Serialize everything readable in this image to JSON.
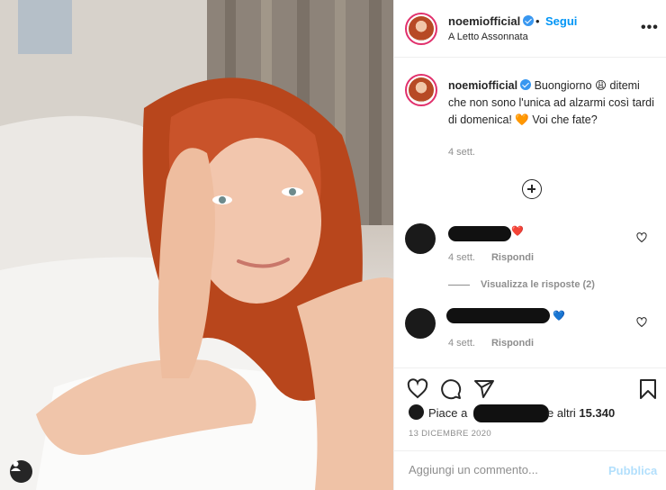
{
  "post": {
    "username": "noemiofficial",
    "follow_label": "Segui",
    "dot": "•",
    "location": "A Letto Assonnata",
    "more": "•••",
    "caption_text": "Buongiorno 😩 ditemi che non sono l'unica ad alzarmi così tardi di domenica! 🧡 Voi che fate?",
    "caption_time": "4 sett."
  },
  "comments": [
    {
      "emoji": "❤️",
      "time": "4 sett.",
      "reply_label": "Rispondi"
    },
    {
      "emoji": "💙",
      "time": "4 sett.",
      "reply_label": "Rispondi"
    }
  ],
  "view_replies": "Visualizza le risposte (2)",
  "likes": {
    "prefix": "Piace a",
    "suffix_pre": "e altri",
    "count": "15.340"
  },
  "date": "13 DICEMBRE 2020",
  "comment_box": {
    "placeholder": "Aggiungi un commento...",
    "publish_label": "Pubblica"
  },
  "icons": [
    "user-tag-icon",
    "verified-badge-icon",
    "more-options-icon",
    "load-more-comments-icon",
    "like-icon",
    "comment-icon",
    "share-icon",
    "save-icon"
  ],
  "colors": {
    "link_blue": "#0095f6",
    "verified_blue": "#3897f0",
    "muted": "#8e8e8e",
    "publish_disabled": "#b2dffc"
  }
}
